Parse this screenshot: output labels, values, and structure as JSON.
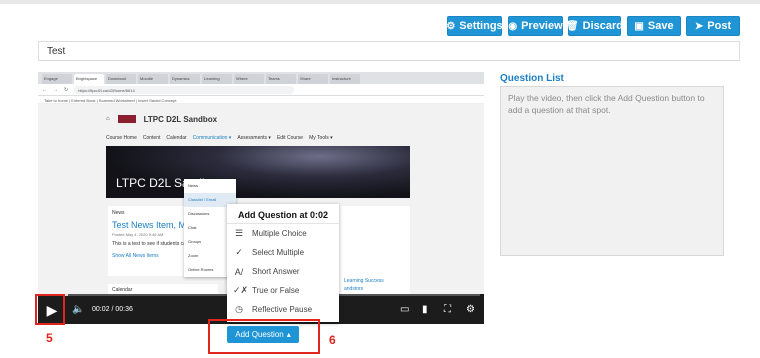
{
  "toolbar": {
    "settings": "Settings",
    "preview": "Preview",
    "discard": "Discard",
    "save": "Save",
    "post": "Post"
  },
  "title_value": "Test",
  "browser": {
    "tabs": [
      "Engage",
      "Brightspace",
      "Download",
      "Moodle",
      "Dynamics",
      "Learning",
      "Where",
      "Teams",
      "Share",
      "Instructure"
    ],
    "url": "https://ltpcd2l.ca/d2l/home/6614",
    "bookmarks": "Take to home | Entered Book | Scanned Worksheet | Insert Saved Concept"
  },
  "d2l": {
    "site_name": "LTPC D2L Sandbox",
    "nav": [
      "Course Home",
      "Content",
      "Calendar",
      "Communication ▾",
      "Assessments ▾",
      "Edit Course",
      "My Tools ▾"
    ],
    "banner_title": "LTPC D2L Sandbox",
    "news_label": "News",
    "news_title": "Test News Item, May",
    "news_meta": "Posted May 4, 2020 9:46 AM",
    "news_body": "This is a test to see if students can see it.",
    "news_all": "Show All News Items",
    "calendar_label": "Calendar",
    "right_links": [
      "Learning Success",
      "andstors"
    ],
    "dropdown": [
      "News",
      "Classlist / Email",
      "Discussions",
      "Chat",
      "Groups",
      "Zoom",
      "Online Rooms"
    ]
  },
  "player": {
    "time": "00:02 / 00:36",
    "progress": 0.06
  },
  "popup": {
    "header": "Add Question at 0:02",
    "items": [
      {
        "label": "Multiple Choice",
        "icon": "list-icon"
      },
      {
        "label": "Select Multiple",
        "icon": "check-icon"
      },
      {
        "label": "Short Answer",
        "icon": "text-icon"
      },
      {
        "label": "True or False",
        "icon": "true-false-icon"
      },
      {
        "label": "Reflective Pause",
        "icon": "pause-icon"
      }
    ]
  },
  "add_question": "Add Question",
  "annotations": {
    "play_num": "5",
    "add_num": "6"
  },
  "question_list": {
    "title": "Question List",
    "hint": "Play the video, then click the Add Question button to add a question at that spot."
  },
  "colors": {
    "accent": "#1f95d6",
    "annotation": "#e0251f",
    "link": "#1c7fc4"
  }
}
